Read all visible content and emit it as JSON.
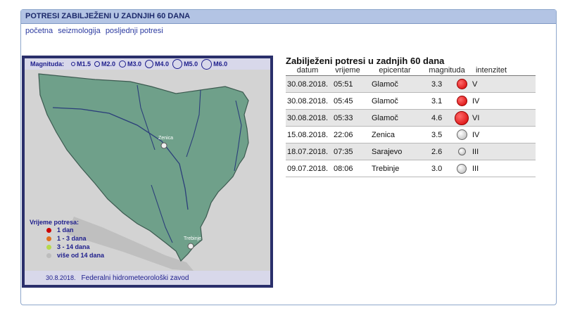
{
  "header": {
    "title": "POTRESI ZABILJEŽENI U ZADNJIH 60 DANA"
  },
  "nav": [
    {
      "label": "početna"
    },
    {
      "label": "seizmologija"
    },
    {
      "label": "posljednji potresi"
    }
  ],
  "map": {
    "legend_magnitude": {
      "label": "Magnituda:",
      "options": [
        "M1.5",
        "M2.0",
        "M3.0",
        "M4.0",
        "M5.0",
        "M6.0"
      ]
    },
    "legend_time": {
      "label": "Vrijeme potresa:",
      "items": [
        {
          "label": "1 dan",
          "color": "#cc0000"
        },
        {
          "label": "1 -  3 dana",
          "color": "#e07020"
        },
        {
          "label": "3 - 14 dana",
          "color": "#b6d94a"
        },
        {
          "label": "više od 14 dana",
          "color": "#bdbdbd"
        }
      ]
    },
    "city_labels": [
      "Zenica",
      "Trebinje"
    ],
    "footer_date": "30.8.2018.",
    "footer_org": "Federalni hidrometeorološki zavod",
    "colors": {
      "land": "#6fa08a",
      "frame": "#2a2f6b",
      "river": "#2b3e7a"
    }
  },
  "table": {
    "title": "Zabilježeni potresi u zadnjih 60 dana",
    "headers": [
      "datum",
      "vrijeme",
      "epicentar",
      "magnituda",
      "intenzitet"
    ],
    "rows": [
      {
        "date": "30.08.2018.",
        "time": "05:51",
        "epicenter": "Glamoč",
        "magnitude": "3.3",
        "intensity": "V",
        "icon": "red-circle-icon"
      },
      {
        "date": "30.08.2018.",
        "time": "05:45",
        "epicenter": "Glamoč",
        "magnitude": "3.1",
        "intensity": "IV",
        "icon": "red-circle-icon"
      },
      {
        "date": "30.08.2018.",
        "time": "05:33",
        "epicenter": "Glamoč",
        "magnitude": "4.6",
        "intensity": "VI",
        "icon": "red-circle-icon"
      },
      {
        "date": "15.08.2018.",
        "time": "22:06",
        "epicenter": "Zenica",
        "magnitude": "3.5",
        "intensity": "IV",
        "icon": "grey-circle-icon"
      },
      {
        "date": "18.07.2018.",
        "time": "07:35",
        "epicenter": "Sarajevo",
        "magnitude": "2.6",
        "intensity": "III",
        "icon": "grey-circle-icon"
      },
      {
        "date": "09.07.2018.",
        "time": "08:06",
        "epicenter": "Trebinje",
        "magnitude": "3.0",
        "intensity": "III",
        "icon": "grey-circle-icon"
      }
    ]
  }
}
